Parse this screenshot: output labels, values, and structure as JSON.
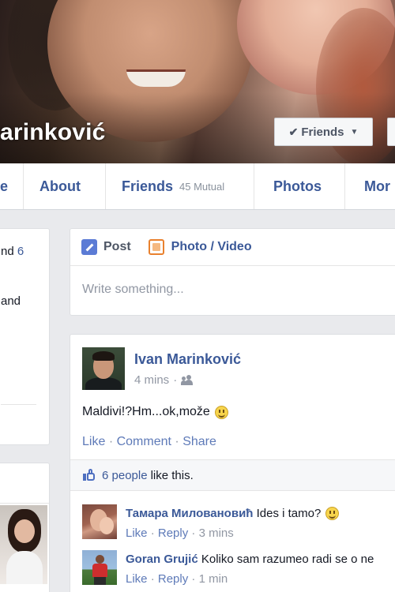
{
  "cover": {
    "name": "arinković",
    "friends_button": "Friends"
  },
  "nav": {
    "tabs": [
      {
        "label": "e"
      },
      {
        "label": "About"
      },
      {
        "label": "Friends",
        "sub": "45 Mutual"
      },
      {
        "label": "Photos"
      },
      {
        "label": "Mor"
      }
    ]
  },
  "left": {
    "intro_line1_prefix": "nd",
    "intro_line1_link": "6",
    "intro_line2": "and"
  },
  "composer": {
    "post_label": "Post",
    "photo_label": "Photo / Video",
    "placeholder": "Write something..."
  },
  "post": {
    "author": "Ivan Marinković",
    "time": "4 mins",
    "separator": "·",
    "text": "Maldivi!?Hm...ok,može",
    "actions": {
      "like": "Like",
      "comment": "Comment",
      "share": "Share",
      "sep": "·"
    },
    "likes": {
      "link": "6 people",
      "text": "like this."
    },
    "comments": [
      {
        "name": "Тамара Миловановић",
        "text": "Ides i tamo?",
        "like": "Like",
        "reply": "Reply",
        "time": "3 mins"
      },
      {
        "name": "Goran Grujić",
        "text": "Koliko sam razumeo radi se o ne",
        "like": "Like",
        "reply": "Reply",
        "time": "1 min"
      }
    ]
  }
}
